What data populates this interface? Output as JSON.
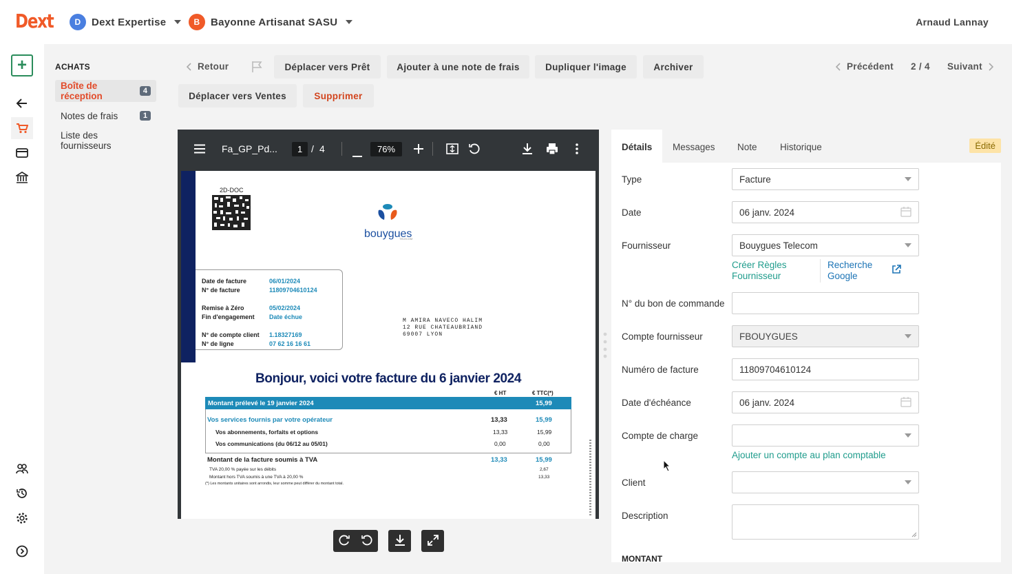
{
  "app": {
    "logo": "Dext"
  },
  "header": {
    "workspace1": {
      "initial": "D",
      "name": "Dext Expertise",
      "color": "#4a7fe0"
    },
    "workspace2": {
      "initial": "B",
      "name": "Bayonne Artisanat SASU",
      "color": "#f05a28"
    },
    "user": "Arnaud Lannay"
  },
  "sidebar": {
    "section": "ACHATS",
    "items": [
      {
        "label": "Boîte de réception",
        "count": "4"
      },
      {
        "label": "Notes de frais",
        "count": "1"
      },
      {
        "label": "Liste des fournisseurs"
      }
    ]
  },
  "toolbar": {
    "back": "Retour",
    "move_ready": "Déplacer vers Prêt",
    "add_expense": "Ajouter à une note de frais",
    "duplicate": "Dupliquer l'image",
    "archive": "Archiver",
    "move_sales": "Déplacer vers Ventes",
    "delete": "Supprimer",
    "previous": "Précédent",
    "position": "2 / 4",
    "next": "Suivant"
  },
  "pdf": {
    "filename": "Fa_GP_Pd...",
    "page": "1",
    "page_sep": "/",
    "pages": "4",
    "zoom": "76%",
    "doc": {
      "code": "2D-DOC",
      "brand": "bouygues",
      "brand_sub": "TELECOM",
      "rows": [
        {
          "k": "Date de facture",
          "v": "06/01/2024"
        },
        {
          "k": "N° de facture",
          "v": "11809704610124"
        },
        {
          "k": "Remise à Zéro",
          "v": "05/02/2024"
        },
        {
          "k": "Fin d'engagement",
          "v": "Date échue"
        },
        {
          "k": "N° de compte client",
          "v": "1.18327169"
        },
        {
          "k": "N° de ligne",
          "v": "07 62 16 16 61"
        }
      ],
      "address": [
        "M AMIRA NAVECO HALIM",
        "12 RUE CHATEAUBRIAND",
        "69007 LYON"
      ],
      "headline": "Bonjour, voici votre facture du 6 janvier 2024",
      "col_ht": "€ HT",
      "col_ttc": "€ TTC(*)",
      "prelev": "Montant prélevé le 19 janvier 2024",
      "prelev_val": "15,99",
      "services": "Vos services fournis par votre opérateur",
      "services_ht": "13,33",
      "services_ttc": "15,99",
      "sub1": "Vos abonnements, forfaits et options",
      "sub1_ht": "13,33",
      "sub1_ttc": "15,99",
      "sub2": "Vos communications  (du 06/12 au 05/01)",
      "sub2_ht": "0,00",
      "sub2_ttc": "0,00",
      "total": "Montant de la facture soumis à TVA",
      "total_ht": "13,33",
      "total_ttc": "15,99",
      "tva1": "TVA 20,00 % payée sur les débits",
      "tva1_v": "2,67",
      "tva2": "Montant hors TVA soumis à une TVA à 20,00 %",
      "tva2_v": "13,33",
      "note": "(*) Les montants unitaires sont arrondis, leur somme peut différer du montant total."
    }
  },
  "panel": {
    "tabs": [
      "Détails",
      "Messages",
      "Note",
      "Historique"
    ],
    "edited": "Édité",
    "fields": {
      "type_label": "Type",
      "type_value": "Facture",
      "date_label": "Date",
      "date_value": "06 janv. 2024",
      "supplier_label": "Fournisseur",
      "supplier_value": "Bouygues Telecom",
      "create_rules": "Créer Règles Fournisseur",
      "google": "Recherche Google",
      "po_label": "N° du bon de commande",
      "po_value": "",
      "account_label": "Compte fournisseur",
      "account_value": "FBOUYGUES",
      "invoice_no_label": "Numéro de facture",
      "invoice_no_value": "11809704610124",
      "due_label": "Date d'échéance",
      "due_value": "06 janv. 2024",
      "charge_label": "Compte de charge",
      "charge_value": "",
      "add_account": "Ajouter un compte au plan comptable",
      "client_label": "Client",
      "client_value": "",
      "desc_label": "Description",
      "desc_value": "",
      "amount_section": "MONTANT"
    }
  }
}
